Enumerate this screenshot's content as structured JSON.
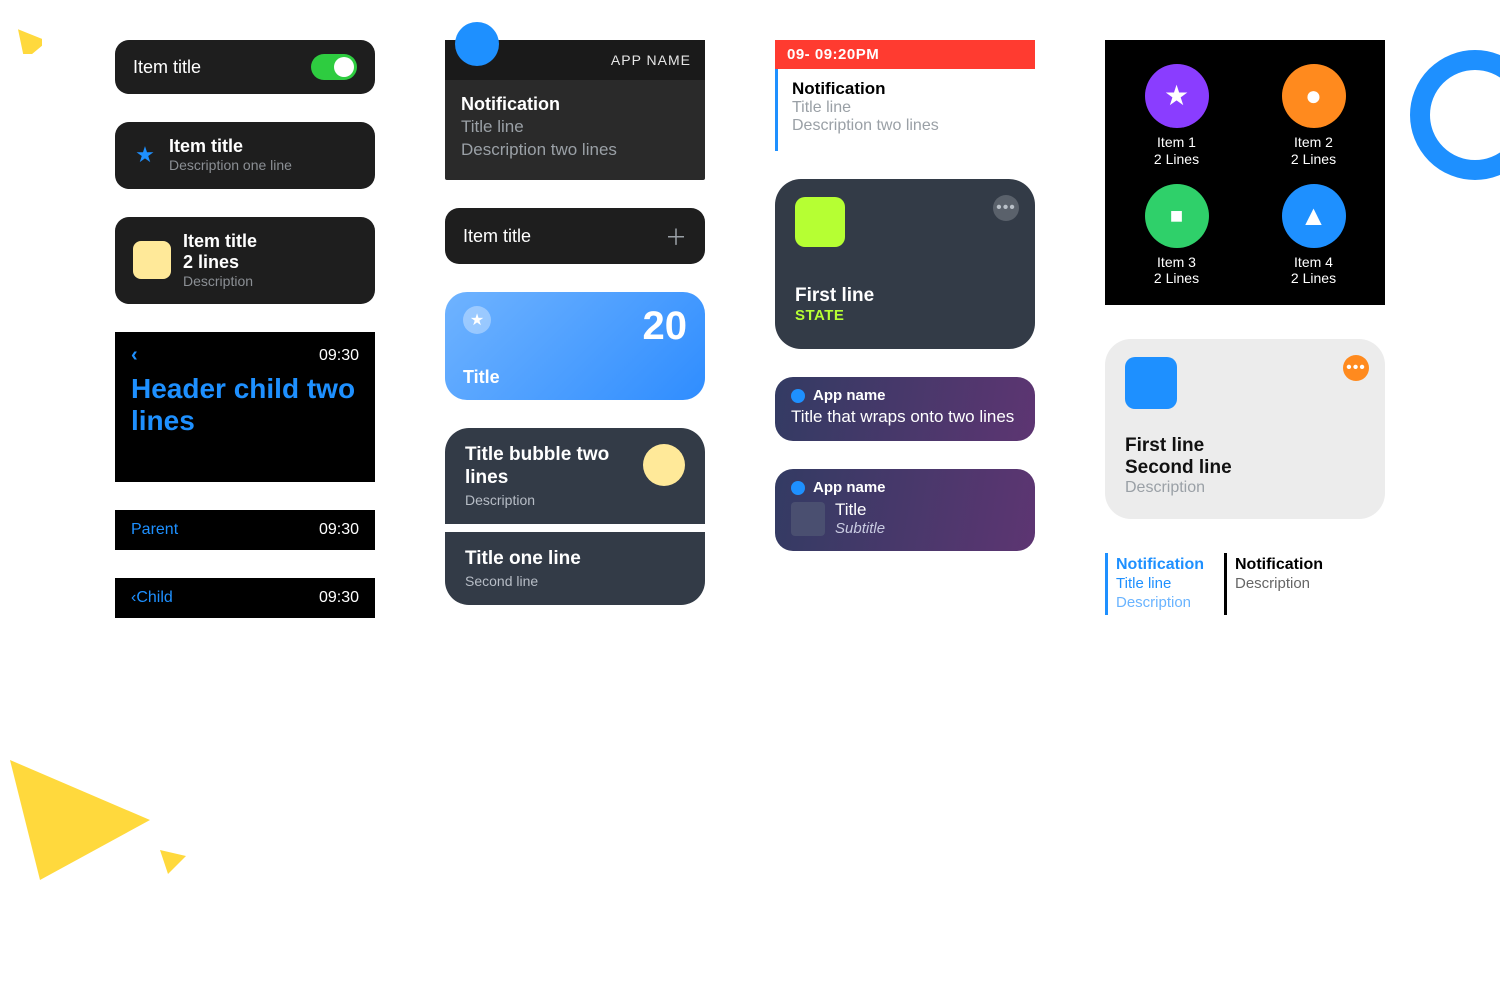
{
  "col1": {
    "toggle_item": {
      "title": "Item title"
    },
    "star_item": {
      "title": "Item title",
      "desc": "Description one line"
    },
    "two_line": {
      "title": "Item title",
      "title2": "2 lines",
      "desc": "Description"
    },
    "header": {
      "time": "09:30",
      "title": "Header child two lines"
    },
    "parent_bar": {
      "label": "Parent",
      "time": "09:30"
    },
    "child_bar": {
      "label": "Child",
      "time": "09:30"
    }
  },
  "col2": {
    "notif": {
      "app": "APP NAME",
      "l1": "Notification",
      "l2": "Title line",
      "l3": "Description two lines"
    },
    "add_item": {
      "title": "Item title"
    },
    "tile": {
      "title": "Title",
      "value": "20"
    },
    "bubble_top": {
      "title": "Title bubble two lines",
      "desc": "Description"
    },
    "bubble_bot": {
      "l1": "Title one line",
      "l2": "Second line"
    }
  },
  "col3": {
    "notif": {
      "time": "09- 09:20PM",
      "l1": "Notification",
      "l2": "Title line",
      "l3": "Description two lines"
    },
    "widget": {
      "l1": "First line",
      "l2": "STATE"
    },
    "pcard1": {
      "app": "App name",
      "txt": "Title that wraps onto two lines"
    },
    "pcard2": {
      "app": "App name",
      "title": "Title",
      "sub": "Subtitle"
    }
  },
  "col4": {
    "grid": [
      {
        "label": "Item 1",
        "sub": "2 Lines"
      },
      {
        "label": "Item 2",
        "sub": "2 Lines"
      },
      {
        "label": "Item 3",
        "sub": "2 Lines"
      },
      {
        "label": "Item 4",
        "sub": "2 Lines"
      }
    ],
    "lwidget": {
      "l1": "First line",
      "l2": "Second line",
      "l3": "Description"
    },
    "snip_blue": {
      "a": "Notification",
      "b": "Title line",
      "c": "Description"
    },
    "snip_black": {
      "a": "Notification",
      "c": "Description"
    }
  }
}
